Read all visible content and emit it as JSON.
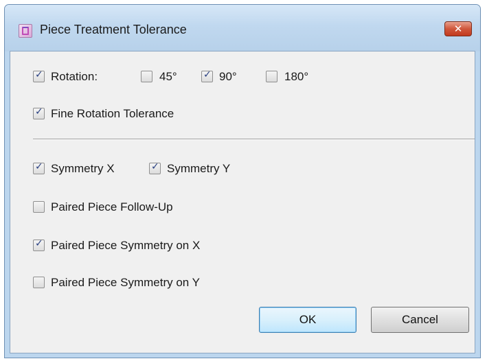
{
  "dialog": {
    "title": "Piece Treatment Tolerance",
    "close_symbol": "✕"
  },
  "options": {
    "rotation": {
      "label": "Rotation:",
      "checked": true
    },
    "rotation_45": {
      "label": "45°",
      "checked": false
    },
    "rotation_90": {
      "label": "90°",
      "checked": true
    },
    "rotation_180": {
      "label": "180°",
      "checked": false
    },
    "fine_rotation": {
      "label": "Fine Rotation Tolerance",
      "checked": true
    },
    "symmetry_x": {
      "label": "Symmetry X",
      "checked": true
    },
    "symmetry_y": {
      "label": "Symmetry Y",
      "checked": true
    },
    "paired_follow_up": {
      "label": "Paired Piece Follow-Up",
      "checked": false
    },
    "paired_symmetry_x": {
      "label": "Paired Piece Symmetry on X",
      "checked": true
    },
    "paired_symmetry_y": {
      "label": "Paired Piece Symmetry on Y",
      "checked": false
    }
  },
  "buttons": {
    "ok": "OK",
    "cancel": "Cancel"
  },
  "icons": {
    "check_glyph": "✓",
    "app": "app-icon",
    "close": "close-icon"
  }
}
